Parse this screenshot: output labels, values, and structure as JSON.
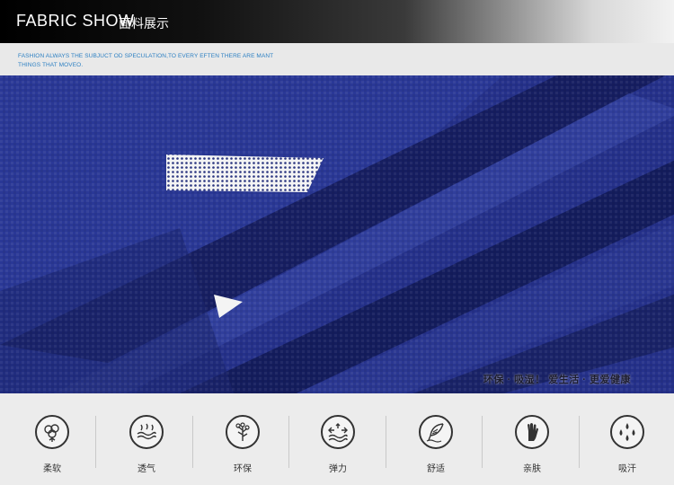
{
  "header": {
    "title": "FABRIC SHOW",
    "subtitle": "面料展示",
    "tagline": "FASHION ALWAYS THE  SUBJUCT OD SPECULATION,TO EVERY EFTEN THERE ARE MANT THINGS THAT MOVEO."
  },
  "fabric": {
    "caption": "环保 · 吸湿！ 爱生活 · 更爱健康"
  },
  "features": [
    {
      "label": "柔软",
      "icon": "cotton-icon"
    },
    {
      "label": "透气",
      "icon": "breathable-icon"
    },
    {
      "label": "环保",
      "icon": "tree-icon"
    },
    {
      "label": "弹力",
      "icon": "elastic-icon"
    },
    {
      "label": "舒适",
      "icon": "feather-icon"
    },
    {
      "label": "亲肤",
      "icon": "hand-icon"
    },
    {
      "label": "吸汗",
      "icon": "sweat-drops-icon"
    }
  ],
  "colors": {
    "fabric": "#1e2a78",
    "tagline": "#2b7fc2"
  }
}
